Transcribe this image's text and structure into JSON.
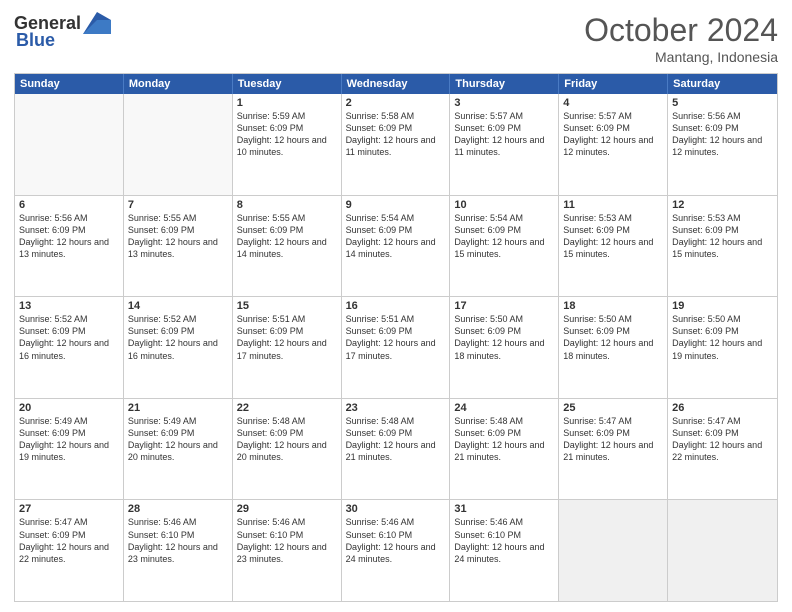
{
  "header": {
    "logo_general": "General",
    "logo_blue": "Blue",
    "month_title": "October 2024",
    "location": "Mantang, Indonesia"
  },
  "days_of_week": [
    "Sunday",
    "Monday",
    "Tuesday",
    "Wednesday",
    "Thursday",
    "Friday",
    "Saturday"
  ],
  "rows": [
    [
      {
        "day": "",
        "empty": true
      },
      {
        "day": "",
        "empty": true
      },
      {
        "day": "1",
        "sunrise": "Sunrise: 5:59 AM",
        "sunset": "Sunset: 6:09 PM",
        "daylight": "Daylight: 12 hours and 10 minutes."
      },
      {
        "day": "2",
        "sunrise": "Sunrise: 5:58 AM",
        "sunset": "Sunset: 6:09 PM",
        "daylight": "Daylight: 12 hours and 11 minutes."
      },
      {
        "day": "3",
        "sunrise": "Sunrise: 5:57 AM",
        "sunset": "Sunset: 6:09 PM",
        "daylight": "Daylight: 12 hours and 11 minutes."
      },
      {
        "day": "4",
        "sunrise": "Sunrise: 5:57 AM",
        "sunset": "Sunset: 6:09 PM",
        "daylight": "Daylight: 12 hours and 12 minutes."
      },
      {
        "day": "5",
        "sunrise": "Sunrise: 5:56 AM",
        "sunset": "Sunset: 6:09 PM",
        "daylight": "Daylight: 12 hours and 12 minutes."
      }
    ],
    [
      {
        "day": "6",
        "sunrise": "Sunrise: 5:56 AM",
        "sunset": "Sunset: 6:09 PM",
        "daylight": "Daylight: 12 hours and 13 minutes."
      },
      {
        "day": "7",
        "sunrise": "Sunrise: 5:55 AM",
        "sunset": "Sunset: 6:09 PM",
        "daylight": "Daylight: 12 hours and 13 minutes."
      },
      {
        "day": "8",
        "sunrise": "Sunrise: 5:55 AM",
        "sunset": "Sunset: 6:09 PM",
        "daylight": "Daylight: 12 hours and 14 minutes."
      },
      {
        "day": "9",
        "sunrise": "Sunrise: 5:54 AM",
        "sunset": "Sunset: 6:09 PM",
        "daylight": "Daylight: 12 hours and 14 minutes."
      },
      {
        "day": "10",
        "sunrise": "Sunrise: 5:54 AM",
        "sunset": "Sunset: 6:09 PM",
        "daylight": "Daylight: 12 hours and 15 minutes."
      },
      {
        "day": "11",
        "sunrise": "Sunrise: 5:53 AM",
        "sunset": "Sunset: 6:09 PM",
        "daylight": "Daylight: 12 hours and 15 minutes."
      },
      {
        "day": "12",
        "sunrise": "Sunrise: 5:53 AM",
        "sunset": "Sunset: 6:09 PM",
        "daylight": "Daylight: 12 hours and 15 minutes."
      }
    ],
    [
      {
        "day": "13",
        "sunrise": "Sunrise: 5:52 AM",
        "sunset": "Sunset: 6:09 PM",
        "daylight": "Daylight: 12 hours and 16 minutes."
      },
      {
        "day": "14",
        "sunrise": "Sunrise: 5:52 AM",
        "sunset": "Sunset: 6:09 PM",
        "daylight": "Daylight: 12 hours and 16 minutes."
      },
      {
        "day": "15",
        "sunrise": "Sunrise: 5:51 AM",
        "sunset": "Sunset: 6:09 PM",
        "daylight": "Daylight: 12 hours and 17 minutes."
      },
      {
        "day": "16",
        "sunrise": "Sunrise: 5:51 AM",
        "sunset": "Sunset: 6:09 PM",
        "daylight": "Daylight: 12 hours and 17 minutes."
      },
      {
        "day": "17",
        "sunrise": "Sunrise: 5:50 AM",
        "sunset": "Sunset: 6:09 PM",
        "daylight": "Daylight: 12 hours and 18 minutes."
      },
      {
        "day": "18",
        "sunrise": "Sunrise: 5:50 AM",
        "sunset": "Sunset: 6:09 PM",
        "daylight": "Daylight: 12 hours and 18 minutes."
      },
      {
        "day": "19",
        "sunrise": "Sunrise: 5:50 AM",
        "sunset": "Sunset: 6:09 PM",
        "daylight": "Daylight: 12 hours and 19 minutes."
      }
    ],
    [
      {
        "day": "20",
        "sunrise": "Sunrise: 5:49 AM",
        "sunset": "Sunset: 6:09 PM",
        "daylight": "Daylight: 12 hours and 19 minutes."
      },
      {
        "day": "21",
        "sunrise": "Sunrise: 5:49 AM",
        "sunset": "Sunset: 6:09 PM",
        "daylight": "Daylight: 12 hours and 20 minutes."
      },
      {
        "day": "22",
        "sunrise": "Sunrise: 5:48 AM",
        "sunset": "Sunset: 6:09 PM",
        "daylight": "Daylight: 12 hours and 20 minutes."
      },
      {
        "day": "23",
        "sunrise": "Sunrise: 5:48 AM",
        "sunset": "Sunset: 6:09 PM",
        "daylight": "Daylight: 12 hours and 21 minutes."
      },
      {
        "day": "24",
        "sunrise": "Sunrise: 5:48 AM",
        "sunset": "Sunset: 6:09 PM",
        "daylight": "Daylight: 12 hours and 21 minutes."
      },
      {
        "day": "25",
        "sunrise": "Sunrise: 5:47 AM",
        "sunset": "Sunset: 6:09 PM",
        "daylight": "Daylight: 12 hours and 21 minutes."
      },
      {
        "day": "26",
        "sunrise": "Sunrise: 5:47 AM",
        "sunset": "Sunset: 6:09 PM",
        "daylight": "Daylight: 12 hours and 22 minutes."
      }
    ],
    [
      {
        "day": "27",
        "sunrise": "Sunrise: 5:47 AM",
        "sunset": "Sunset: 6:09 PM",
        "daylight": "Daylight: 12 hours and 22 minutes."
      },
      {
        "day": "28",
        "sunrise": "Sunrise: 5:46 AM",
        "sunset": "Sunset: 6:10 PM",
        "daylight": "Daylight: 12 hours and 23 minutes."
      },
      {
        "day": "29",
        "sunrise": "Sunrise: 5:46 AM",
        "sunset": "Sunset: 6:10 PM",
        "daylight": "Daylight: 12 hours and 23 minutes."
      },
      {
        "day": "30",
        "sunrise": "Sunrise: 5:46 AM",
        "sunset": "Sunset: 6:10 PM",
        "daylight": "Daylight: 12 hours and 24 minutes."
      },
      {
        "day": "31",
        "sunrise": "Sunrise: 5:46 AM",
        "sunset": "Sunset: 6:10 PM",
        "daylight": "Daylight: 12 hours and 24 minutes."
      },
      {
        "day": "",
        "empty": true,
        "last": true
      },
      {
        "day": "",
        "empty": true,
        "last": true
      }
    ]
  ]
}
